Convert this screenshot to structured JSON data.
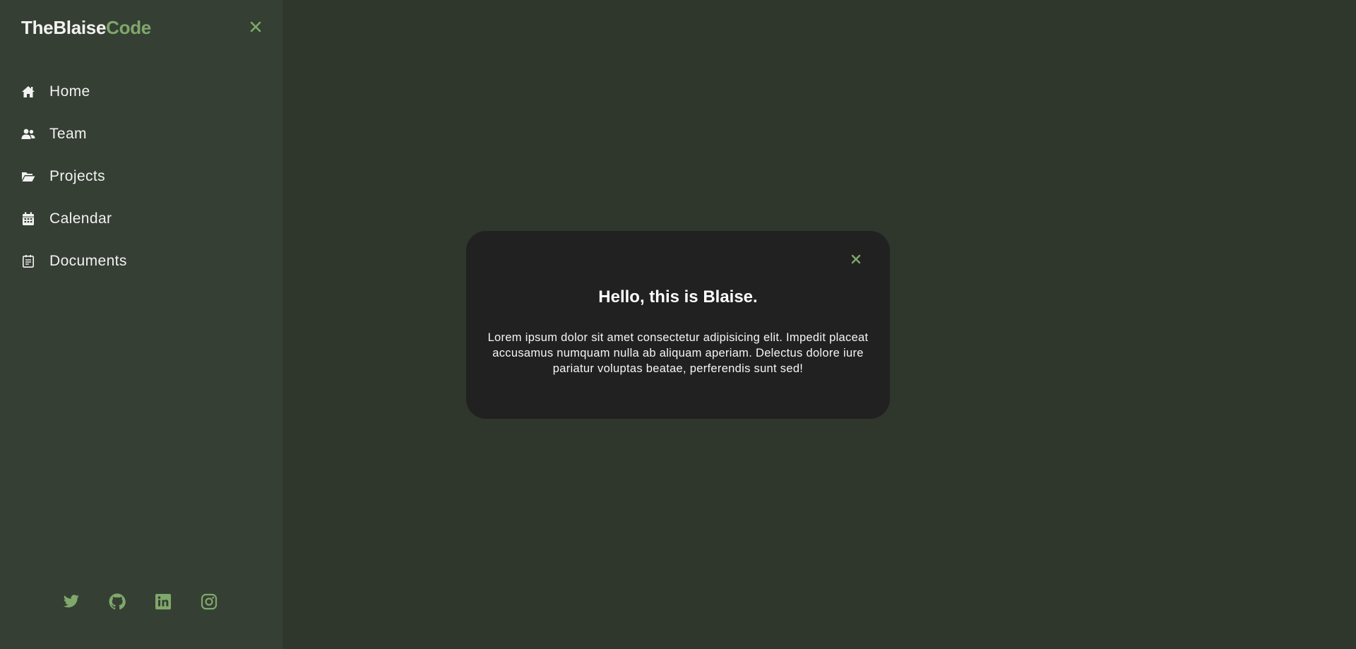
{
  "brand": {
    "part1": "TheBlaise",
    "part2": "Code"
  },
  "colors": {
    "accent": "#7fa86b",
    "sidebar_bg": "#363f34",
    "main_bg": "#2f372d",
    "modal_bg": "#212121"
  },
  "sidebar": {
    "close_icon": "close-icon",
    "items": [
      {
        "label": "Home",
        "icon": "home-icon"
      },
      {
        "label": "Team",
        "icon": "team-icon"
      },
      {
        "label": "Projects",
        "icon": "folder-open-icon"
      },
      {
        "label": "Calendar",
        "icon": "calendar-icon"
      },
      {
        "label": "Documents",
        "icon": "document-icon"
      }
    ],
    "socials": [
      "twitter-icon",
      "github-icon",
      "linkedin-icon",
      "instagram-icon"
    ]
  },
  "modal": {
    "title": "Hello, this is Blaise.",
    "body": "Lorem ipsum dolor sit amet consectetur adipisicing elit. Impedit placeat accusamus numquam nulla ab aliquam aperiam. Delectus dolore iure pariatur voluptas beatae, perferendis sunt sed!",
    "close_icon": "close-icon"
  }
}
